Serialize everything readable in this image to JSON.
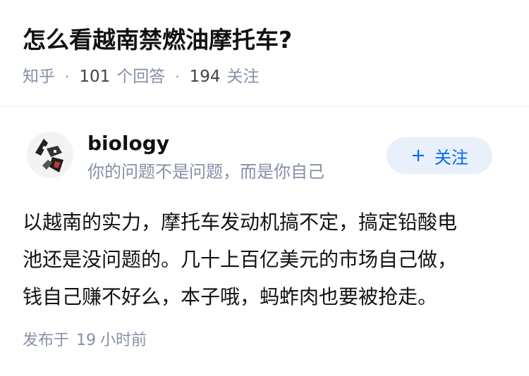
{
  "question": {
    "title": "怎么看越南禁燃油摩托车?",
    "source": "知乎",
    "answer_count": "101",
    "answer_count_label": "个回答",
    "follower_count": "194",
    "follower_count_label": "关注",
    "separator": "·"
  },
  "answer": {
    "author": {
      "name": "biology",
      "bio": "你的问题不是问题，而是你自己",
      "avatar_icon": "avatar-image"
    },
    "follow_button": {
      "icon": "plus-icon",
      "label": "关注"
    },
    "content_lines": [
      "以越南的实力，摩托车发动机搞不定，搞定铅酸电",
      "池还是没问题的。几十上百亿美元的市场自己做，",
      "钱自己赚不好么，本子哦，蚂蚱肉也要被抢走。"
    ],
    "posted": {
      "prefix": "发布于",
      "count": "19",
      "unit": "小时前"
    }
  },
  "colors": {
    "primary_text": "#121212",
    "secondary_text": "#8590a6",
    "accent": "#0066ff",
    "button_bg": "#e8f0fb",
    "divider": "#ebebeb"
  }
}
